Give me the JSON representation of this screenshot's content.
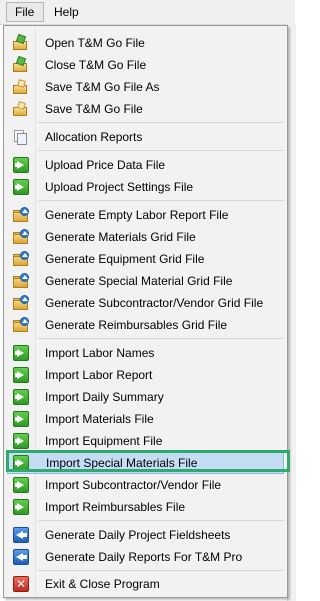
{
  "menubar": {
    "file_label": "File",
    "help_label": "Help"
  },
  "file_menu": {
    "items": [
      {
        "label": "Open T&M Go File",
        "icon": "open-file-icon"
      },
      {
        "label": "Close T&M Go File",
        "icon": "close-file-icon"
      },
      {
        "label": "Save T&M Go File As",
        "icon": "save-as-icon"
      },
      {
        "label": "Save T&M Go File",
        "icon": "save-icon"
      },
      {
        "label": "Allocation Reports",
        "icon": "reports-icon"
      },
      {
        "label": "Upload Price Data File",
        "icon": "green-arrow-icon"
      },
      {
        "label": "Upload Project Settings File",
        "icon": "green-arrow-icon"
      },
      {
        "label": "Generate Empty Labor Report File",
        "icon": "folder-upload-icon"
      },
      {
        "label": "Generate Materials Grid File",
        "icon": "folder-upload-icon"
      },
      {
        "label": "Generate Equipment Grid File",
        "icon": "folder-upload-icon"
      },
      {
        "label": "Generate Special Material Grid File",
        "icon": "folder-upload-icon"
      },
      {
        "label": "Generate Subcontractor/Vendor Grid File",
        "icon": "folder-upload-icon"
      },
      {
        "label": "Generate Reimbursables Grid File",
        "icon": "folder-upload-icon"
      },
      {
        "label": "Import Labor Names",
        "icon": "green-arrow-icon"
      },
      {
        "label": "Import Labor Report",
        "icon": "green-arrow-icon"
      },
      {
        "label": "Import Daily Summary",
        "icon": "green-arrow-icon"
      },
      {
        "label": "Import Materials File",
        "icon": "green-arrow-icon"
      },
      {
        "label": "Import Equipment File",
        "icon": "green-arrow-icon"
      },
      {
        "label": "Import Special Materials File",
        "icon": "green-arrow-icon",
        "highlighted": true
      },
      {
        "label": "Import Subcontractor/Vendor File",
        "icon": "green-arrow-icon"
      },
      {
        "label": "Import Reimbursables File",
        "icon": "green-arrow-icon"
      },
      {
        "label": "Generate Daily Project Fieldsheets",
        "icon": "blue-back-arrow-icon"
      },
      {
        "label": "Generate Daily Reports For T&M Pro",
        "icon": "blue-back-arrow-icon"
      },
      {
        "label": "Exit & Close Program",
        "icon": "exit-icon"
      }
    ]
  },
  "colors": {
    "highlight_fill": "#c5dcf5",
    "annotation_frame": "#2eaa6a",
    "menu_bg": "#f2f2f2"
  }
}
